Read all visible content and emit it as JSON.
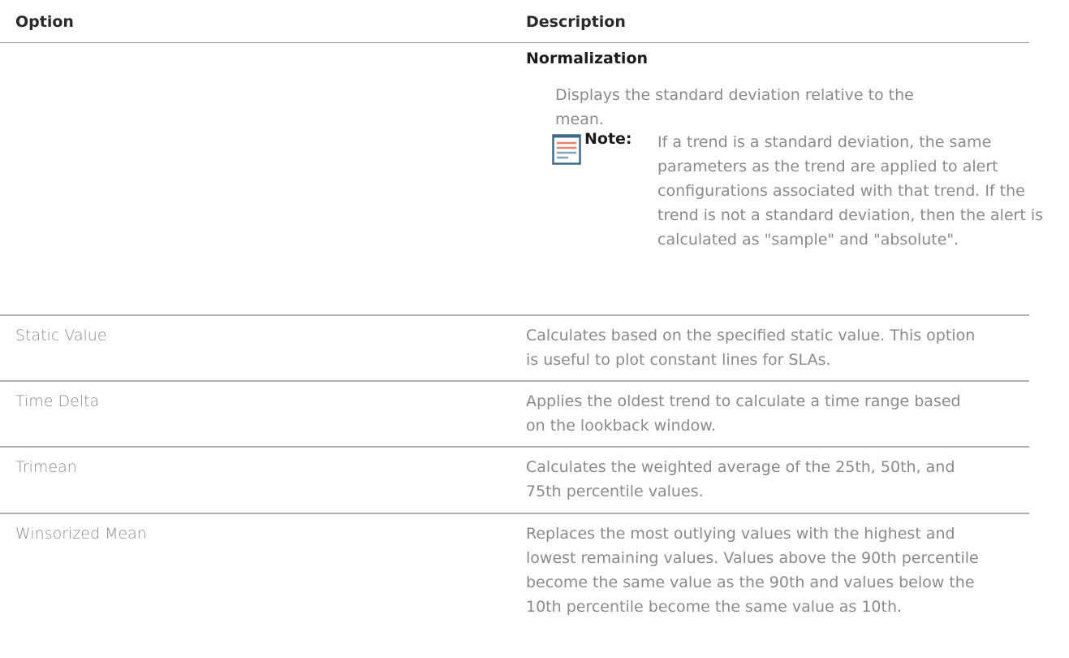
{
  "table": {
    "headers": {
      "option": "Option",
      "description": "Description"
    },
    "normalization": {
      "title": "Normalization",
      "text": "Displays the standard deviation relative to the mean.",
      "note_icon": "note-document-icon",
      "note_label": "Note:",
      "note_text": "If a trend is a standard deviation, the same parameters as the trend are applied to alert configurations associated with that trend. If the trend is not a standard deviation, then the alert is calculated as \"sample\" and \"absolute\"."
    },
    "rows": [
      {
        "option": "Static Value",
        "description": "Calculates based on the specified static value. This option is useful to plot constant lines for SLAs."
      },
      {
        "option": "Time Delta",
        "description": "Applies the oldest trend to calculate a time range based on the lookback window."
      },
      {
        "option": "Trimean",
        "description": "Calculates the weighted average of the 25th, 50th, and 75th percentile values."
      },
      {
        "option": "Winsorized Mean",
        "description": "Replaces the most outlying values with the highest and lowest remaining values. Values above the 90th percentile become the same value as the 90th and values below the 10th percentile become the same value as 10th."
      }
    ]
  },
  "colors": {
    "note_icon_accent": "#e8836a",
    "note_icon_frame": "#3d6a8a"
  }
}
